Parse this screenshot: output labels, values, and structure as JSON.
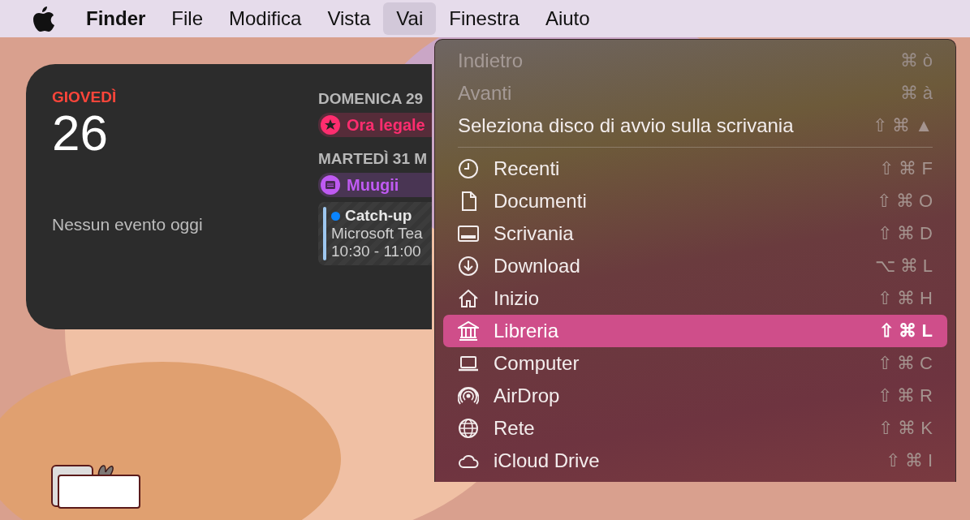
{
  "menu_bar": {
    "items": [
      {
        "label": "Finder",
        "selected": false,
        "app": true
      },
      {
        "label": "File",
        "selected": false,
        "app": false
      },
      {
        "label": "Modifica",
        "selected": false,
        "app": false
      },
      {
        "label": "Vista",
        "selected": false,
        "app": false
      },
      {
        "label": "Vai",
        "selected": true,
        "app": false
      },
      {
        "label": "Finestra",
        "selected": false,
        "app": false
      },
      {
        "label": "Aiuto",
        "selected": false,
        "app": false
      }
    ]
  },
  "calendar_widget": {
    "weekday": "GIOVEDÌ",
    "day": "26",
    "no_events": "Nessun evento oggi",
    "days": [
      {
        "heading": "DOMENICA 29",
        "events": [
          {
            "kind": "holiday",
            "title": "Ora legale",
            "color": "#ff2d6f"
          }
        ]
      },
      {
        "heading": "MARTEDÌ 31 M",
        "events": [
          {
            "kind": "allday",
            "title": "Muugii",
            "color": "#bf5af2"
          },
          {
            "kind": "timed",
            "title": "Catch-up",
            "place": "Microsoft Tea",
            "time": "10:30 - 11:00",
            "color": "#0a84ff"
          }
        ]
      }
    ]
  },
  "go_menu": {
    "sections": [
      {
        "items": [
          {
            "label": "Indietro",
            "shortcut": "⌘ ò",
            "disabled": true,
            "selected": false
          },
          {
            "label": "Avanti",
            "shortcut": "⌘ à",
            "disabled": true,
            "selected": false
          },
          {
            "label": "Seleziona disco di avvio sulla scrivania",
            "shortcut": "⇧ ⌘ ▲",
            "disabled": false,
            "selected": false
          }
        ]
      },
      {
        "items": [
          {
            "label": "Recenti",
            "shortcut": "⇧ ⌘ F",
            "disabled": false,
            "selected": false
          },
          {
            "label": "Documenti",
            "shortcut": "⇧ ⌘ O",
            "disabled": false,
            "selected": false
          },
          {
            "label": "Scrivania",
            "shortcut": "⇧ ⌘ D",
            "disabled": false,
            "selected": false
          },
          {
            "label": "Download",
            "shortcut": "⌥ ⌘ L",
            "disabled": false,
            "selected": false
          },
          {
            "label": "Inizio",
            "shortcut": "⇧ ⌘ H",
            "disabled": false,
            "selected": false
          },
          {
            "label": "Libreria",
            "shortcut": "⇧ ⌘ L",
            "disabled": false,
            "selected": true
          },
          {
            "label": "Computer",
            "shortcut": "⇧ ⌘ C",
            "disabled": false,
            "selected": false
          },
          {
            "label": "AirDrop",
            "shortcut": "⇧ ⌘ R",
            "disabled": false,
            "selected": false
          },
          {
            "label": "Rete",
            "shortcut": "⇧ ⌘ K",
            "disabled": false,
            "selected": false
          },
          {
            "label": "iCloud Drive",
            "shortcut": "⇧ ⌘ I",
            "disabled": false,
            "selected": false
          }
        ]
      }
    ]
  }
}
